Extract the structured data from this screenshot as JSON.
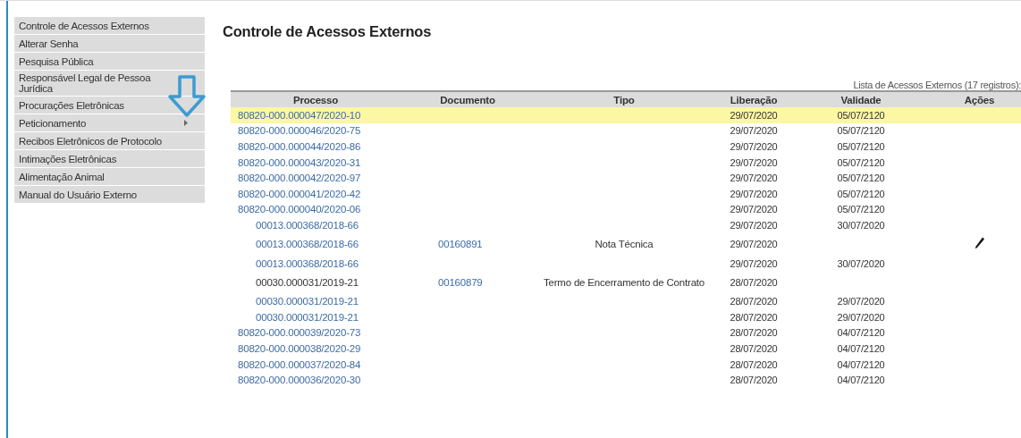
{
  "sidebar": {
    "items": [
      {
        "label": "Controle de Acessos Externos",
        "submenu": false
      },
      {
        "label": "Alterar Senha",
        "submenu": false
      },
      {
        "label": "Pesquisa Pública",
        "submenu": false
      },
      {
        "label": "Responsável Legal de Pessoa Jurídica",
        "submenu": false
      },
      {
        "label": "Procurações Eletrônicas",
        "submenu": false
      },
      {
        "label": "Peticionamento",
        "submenu": true
      },
      {
        "label": "Recibos Eletrônicos de Protocolo",
        "submenu": false
      },
      {
        "label": "Intimações Eletrônicas",
        "submenu": false
      },
      {
        "label": "Alimentação Animal",
        "submenu": false
      },
      {
        "label": "Manual do Usuário Externo",
        "submenu": false
      }
    ]
  },
  "page_title": "Controle de Acessos Externos",
  "table": {
    "caption": "Lista de Acessos Externos (17 registros):",
    "columns": [
      "Processo",
      "Documento",
      "Tipo",
      "Liberação",
      "Validade",
      "Ações"
    ],
    "rows": [
      {
        "kind": "main",
        "selected": true,
        "processo": "80820-000.000047/2020-10",
        "link": true,
        "liberacao": "29/07/2020",
        "validade": "05/07/2120",
        "edit": false
      },
      {
        "kind": "main",
        "selected": false,
        "processo": "80820-000.000046/2020-75",
        "link": true,
        "liberacao": "29/07/2020",
        "validade": "05/07/2120",
        "edit": false
      },
      {
        "kind": "main",
        "selected": false,
        "processo": "80820-000.000044/2020-86",
        "link": true,
        "liberacao": "29/07/2020",
        "validade": "05/07/2120",
        "edit": false
      },
      {
        "kind": "main",
        "selected": false,
        "processo": "80820-000.000043/2020-31",
        "link": true,
        "liberacao": "29/07/2020",
        "validade": "05/07/2120",
        "edit": false
      },
      {
        "kind": "main",
        "selected": false,
        "processo": "80820-000.000042/2020-97",
        "link": true,
        "liberacao": "29/07/2020",
        "validade": "05/07/2120",
        "edit": false
      },
      {
        "kind": "main",
        "selected": false,
        "processo": "80820-000.000041/2020-42",
        "link": true,
        "liberacao": "29/07/2020",
        "validade": "05/07/2120",
        "edit": false
      },
      {
        "kind": "main",
        "selected": false,
        "processo": "80820-000.000040/2020-06",
        "link": true,
        "liberacao": "29/07/2020",
        "validade": "05/07/2120",
        "edit": false
      },
      {
        "kind": "sub",
        "selected": false,
        "processo": "00013.000368/2018-66",
        "link": true,
        "liberacao": "29/07/2020",
        "validade": "30/07/2020",
        "edit": false
      },
      {
        "kind": "sub",
        "selected": false,
        "processo": "00013.000368/2018-66",
        "link": true,
        "documento": "00160891",
        "tipo": "Nota Técnica",
        "liberacao": "29/07/2020",
        "edit": true
      },
      {
        "kind": "sub",
        "selected": false,
        "processo": "00013.000368/2018-66",
        "link": true,
        "liberacao": "29/07/2020",
        "validade": "30/07/2020",
        "edit": false
      },
      {
        "kind": "sub",
        "selected": false,
        "processo": "00030.000031/2019-21",
        "link": false,
        "documento": "00160879",
        "tipo": "Termo de Encerramento de Contrato",
        "liberacao": "28/07/2020",
        "edit": false
      },
      {
        "kind": "sub",
        "selected": false,
        "processo": "00030.000031/2019-21",
        "link": true,
        "liberacao": "28/07/2020",
        "validade": "29/07/2020",
        "edit": false
      },
      {
        "kind": "sub",
        "selected": false,
        "processo": "00030.000031/2019-21",
        "link": true,
        "liberacao": "28/07/2020",
        "validade": "29/07/2020",
        "edit": false
      },
      {
        "kind": "main",
        "selected": false,
        "processo": "80820-000.000039/2020-73",
        "link": true,
        "liberacao": "28/07/2020",
        "validade": "04/07/2120",
        "edit": false
      },
      {
        "kind": "main",
        "selected": false,
        "processo": "80820-000.000038/2020-29",
        "link": true,
        "liberacao": "28/07/2020",
        "validade": "04/07/2120",
        "edit": false
      },
      {
        "kind": "main",
        "selected": false,
        "processo": "80820-000.000037/2020-84",
        "link": true,
        "liberacao": "28/07/2020",
        "validade": "04/07/2120",
        "edit": false
      },
      {
        "kind": "main",
        "selected": false,
        "processo": "80820-000.000036/2020-30",
        "link": true,
        "liberacao": "28/07/2020",
        "validade": "04/07/2120",
        "edit": false
      }
    ]
  }
}
